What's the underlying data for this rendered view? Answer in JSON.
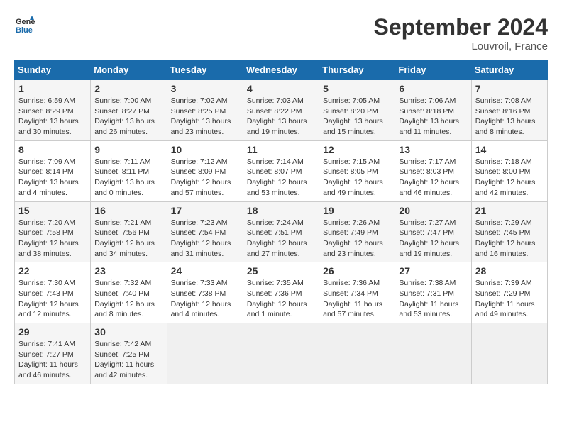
{
  "header": {
    "logo_line1": "General",
    "logo_line2": "Blue",
    "month": "September 2024",
    "location": "Louvroil, France"
  },
  "weekdays": [
    "Sunday",
    "Monday",
    "Tuesday",
    "Wednesday",
    "Thursday",
    "Friday",
    "Saturday"
  ],
  "weeks": [
    [
      {
        "day": "1",
        "info": "Sunrise: 6:59 AM\nSunset: 8:29 PM\nDaylight: 13 hours and 30 minutes."
      },
      {
        "day": "2",
        "info": "Sunrise: 7:00 AM\nSunset: 8:27 PM\nDaylight: 13 hours and 26 minutes."
      },
      {
        "day": "3",
        "info": "Sunrise: 7:02 AM\nSunset: 8:25 PM\nDaylight: 13 hours and 23 minutes."
      },
      {
        "day": "4",
        "info": "Sunrise: 7:03 AM\nSunset: 8:22 PM\nDaylight: 13 hours and 19 minutes."
      },
      {
        "day": "5",
        "info": "Sunrise: 7:05 AM\nSunset: 8:20 PM\nDaylight: 13 hours and 15 minutes."
      },
      {
        "day": "6",
        "info": "Sunrise: 7:06 AM\nSunset: 8:18 PM\nDaylight: 13 hours and 11 minutes."
      },
      {
        "day": "7",
        "info": "Sunrise: 7:08 AM\nSunset: 8:16 PM\nDaylight: 13 hours and 8 minutes."
      }
    ],
    [
      {
        "day": "8",
        "info": "Sunrise: 7:09 AM\nSunset: 8:14 PM\nDaylight: 13 hours and 4 minutes."
      },
      {
        "day": "9",
        "info": "Sunrise: 7:11 AM\nSunset: 8:11 PM\nDaylight: 13 hours and 0 minutes."
      },
      {
        "day": "10",
        "info": "Sunrise: 7:12 AM\nSunset: 8:09 PM\nDaylight: 12 hours and 57 minutes."
      },
      {
        "day": "11",
        "info": "Sunrise: 7:14 AM\nSunset: 8:07 PM\nDaylight: 12 hours and 53 minutes."
      },
      {
        "day": "12",
        "info": "Sunrise: 7:15 AM\nSunset: 8:05 PM\nDaylight: 12 hours and 49 minutes."
      },
      {
        "day": "13",
        "info": "Sunrise: 7:17 AM\nSunset: 8:03 PM\nDaylight: 12 hours and 46 minutes."
      },
      {
        "day": "14",
        "info": "Sunrise: 7:18 AM\nSunset: 8:00 PM\nDaylight: 12 hours and 42 minutes."
      }
    ],
    [
      {
        "day": "15",
        "info": "Sunrise: 7:20 AM\nSunset: 7:58 PM\nDaylight: 12 hours and 38 minutes."
      },
      {
        "day": "16",
        "info": "Sunrise: 7:21 AM\nSunset: 7:56 PM\nDaylight: 12 hours and 34 minutes."
      },
      {
        "day": "17",
        "info": "Sunrise: 7:23 AM\nSunset: 7:54 PM\nDaylight: 12 hours and 31 minutes."
      },
      {
        "day": "18",
        "info": "Sunrise: 7:24 AM\nSunset: 7:51 PM\nDaylight: 12 hours and 27 minutes."
      },
      {
        "day": "19",
        "info": "Sunrise: 7:26 AM\nSunset: 7:49 PM\nDaylight: 12 hours and 23 minutes."
      },
      {
        "day": "20",
        "info": "Sunrise: 7:27 AM\nSunset: 7:47 PM\nDaylight: 12 hours and 19 minutes."
      },
      {
        "day": "21",
        "info": "Sunrise: 7:29 AM\nSunset: 7:45 PM\nDaylight: 12 hours and 16 minutes."
      }
    ],
    [
      {
        "day": "22",
        "info": "Sunrise: 7:30 AM\nSunset: 7:43 PM\nDaylight: 12 hours and 12 minutes."
      },
      {
        "day": "23",
        "info": "Sunrise: 7:32 AM\nSunset: 7:40 PM\nDaylight: 12 hours and 8 minutes."
      },
      {
        "day": "24",
        "info": "Sunrise: 7:33 AM\nSunset: 7:38 PM\nDaylight: 12 hours and 4 minutes."
      },
      {
        "day": "25",
        "info": "Sunrise: 7:35 AM\nSunset: 7:36 PM\nDaylight: 12 hours and 1 minute."
      },
      {
        "day": "26",
        "info": "Sunrise: 7:36 AM\nSunset: 7:34 PM\nDaylight: 11 hours and 57 minutes."
      },
      {
        "day": "27",
        "info": "Sunrise: 7:38 AM\nSunset: 7:31 PM\nDaylight: 11 hours and 53 minutes."
      },
      {
        "day": "28",
        "info": "Sunrise: 7:39 AM\nSunset: 7:29 PM\nDaylight: 11 hours and 49 minutes."
      }
    ],
    [
      {
        "day": "29",
        "info": "Sunrise: 7:41 AM\nSunset: 7:27 PM\nDaylight: 11 hours and 46 minutes."
      },
      {
        "day": "30",
        "info": "Sunrise: 7:42 AM\nSunset: 7:25 PM\nDaylight: 11 hours and 42 minutes."
      },
      {
        "day": "",
        "info": ""
      },
      {
        "day": "",
        "info": ""
      },
      {
        "day": "",
        "info": ""
      },
      {
        "day": "",
        "info": ""
      },
      {
        "day": "",
        "info": ""
      }
    ]
  ]
}
